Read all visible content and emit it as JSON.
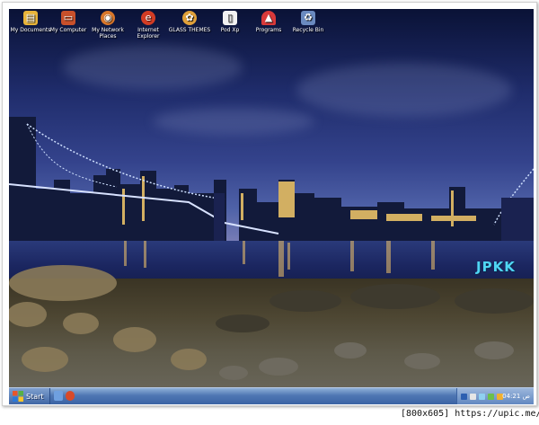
{
  "desktop": {
    "icons": [
      {
        "label_lines": [
          "My Documents"
        ],
        "icon": "documents-folder-icon",
        "color": "#e8b43a"
      },
      {
        "label_lines": [
          "My Computer"
        ],
        "icon": "computer-icon",
        "color": "#c8502b"
      },
      {
        "label_lines": [
          "My Network",
          "Places"
        ],
        "icon": "network-places-icon",
        "color": "#d9772a"
      },
      {
        "label_lines": [
          "Internet",
          "Explorer"
        ],
        "icon": "internet-explorer-icon",
        "color": "#d23c24"
      },
      {
        "label_lines": [
          "GLASS THEMES"
        ],
        "icon": "glass-themes-icon",
        "color": "#e0a13a"
      },
      {
        "label_lines": [
          "Pod Xp"
        ],
        "icon": "pod-xp-icon",
        "color": "#f2f2f2"
      },
      {
        "label_lines": [
          "Programs"
        ],
        "icon": "programs-icon",
        "color": "#d8393a"
      },
      {
        "label_lines": [
          "Recycle Bin"
        ],
        "icon": "recycle-bin-icon",
        "color": "#6a8ac0"
      }
    ],
    "watermark": "JPKK"
  },
  "taskbar": {
    "start_label": "Start",
    "clock": "04:21 ص",
    "quick_launch": [
      "show-desktop-icon",
      "internet-explorer-icon"
    ],
    "tray_icons": [
      "language-icon",
      "volume-icon",
      "network-icon",
      "antivirus-icon",
      "security-icon"
    ]
  },
  "footer": {
    "text": "[800x605] https://upic.me/"
  },
  "colors": {
    "accent": "#4fd5f3",
    "taskbar": "#3b63a4"
  }
}
